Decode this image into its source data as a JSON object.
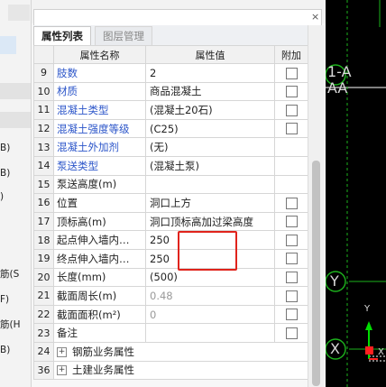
{
  "left_strip": {
    "items": [
      "B)",
      "B)",
      ")",
      "筋(S",
      "F)",
      "筋(H",
      "B)"
    ]
  },
  "tabs": [
    {
      "label": "属性列表",
      "active": true
    },
    {
      "label": "图层管理",
      "active": false
    }
  ],
  "table": {
    "headers": [
      "属性名称",
      "属性值",
      "附加"
    ],
    "rows": [
      {
        "num": "9",
        "name": "肢数",
        "value": "2",
        "blue": true,
        "checkbox": true
      },
      {
        "num": "10",
        "name": "材质",
        "value": "商品混凝土",
        "blue": true,
        "checkbox": true
      },
      {
        "num": "11",
        "name": "混凝土类型",
        "value": "(混凝土20石)",
        "blue": true,
        "checkbox": true
      },
      {
        "num": "12",
        "name": "混凝土强度等级",
        "value": "(C25)",
        "blue": true,
        "checkbox": true
      },
      {
        "num": "13",
        "name": "混凝土外加剂",
        "value": "(无)",
        "blue": true,
        "checkbox": false
      },
      {
        "num": "14",
        "name": "泵送类型",
        "value": "(混凝土泵)",
        "blue": true,
        "checkbox": false
      },
      {
        "num": "15",
        "name": "泵送高度(m)",
        "value": "",
        "blue": false,
        "checkbox": false
      },
      {
        "num": "16",
        "name": "位置",
        "value": "洞口上方",
        "blue": false,
        "checkbox": true
      },
      {
        "num": "17",
        "name": "顶标高(m)",
        "value": "洞口顶标高加过梁高度",
        "blue": false,
        "checkbox": true
      },
      {
        "num": "18",
        "name": "起点伸入墙内…",
        "value": "250",
        "blue": false,
        "checkbox": true
      },
      {
        "num": "19",
        "name": "终点伸入墙内…",
        "value": "250",
        "blue": false,
        "checkbox": true
      },
      {
        "num": "20",
        "name": "长度(mm)",
        "value": "(500)",
        "blue": false,
        "checkbox": true
      },
      {
        "num": "21",
        "name": "截面周长(m)",
        "value": "0.48",
        "blue": false,
        "checkbox": true,
        "gray": true
      },
      {
        "num": "22",
        "name": "截面面积(m²)",
        "value": "0",
        "blue": false,
        "checkbox": true,
        "gray": true
      },
      {
        "num": "23",
        "name": "备注",
        "value": "",
        "blue": false,
        "checkbox": true
      },
      {
        "num": "24",
        "name": "钢筋业务属性",
        "value": "",
        "blue": false,
        "checkbox": false,
        "group": true
      },
      {
        "num": "36",
        "name": "土建业务属性",
        "value": "",
        "blue": false,
        "checkbox": false,
        "group": true
      }
    ]
  },
  "cad": {
    "labels": [
      "1-A",
      "AA",
      "Y",
      "X",
      "Y",
      "X"
    ],
    "colors": {
      "background": "#000000",
      "axis_y": "#00cc00",
      "axis_x": "#ff2020",
      "grid_circle": "#1db21d"
    }
  }
}
